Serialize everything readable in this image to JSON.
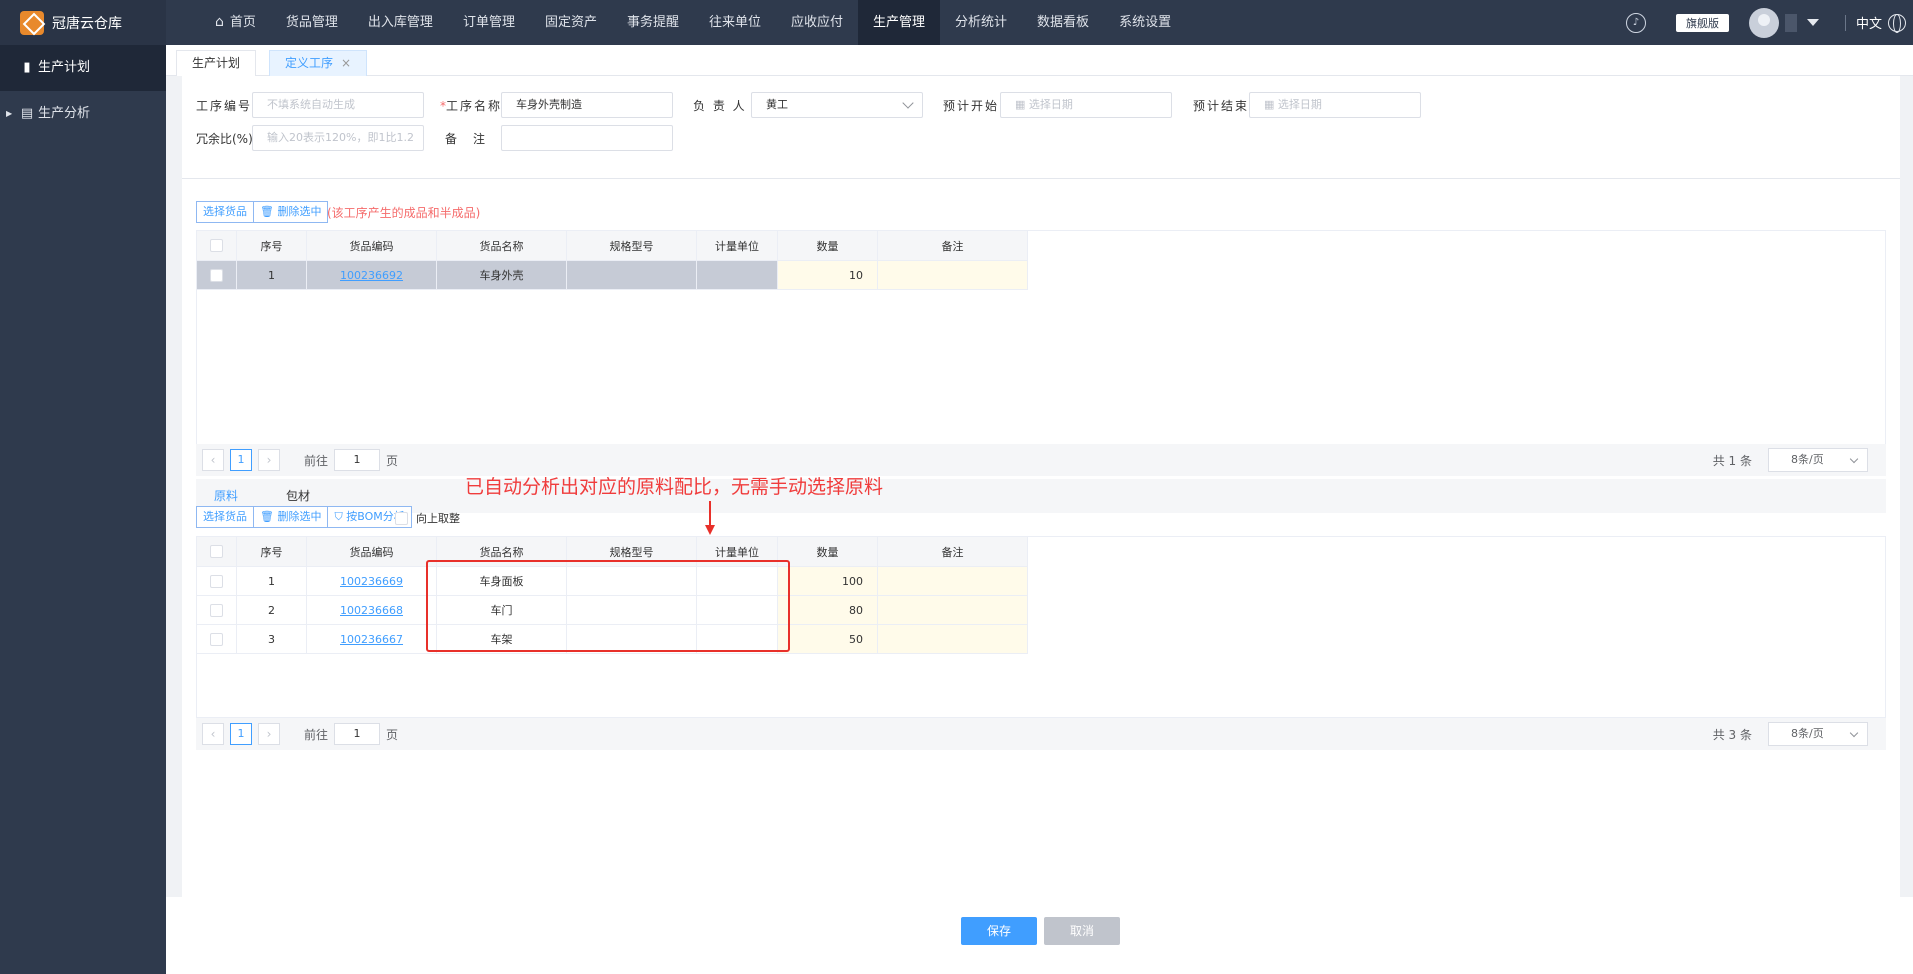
{
  "app": {
    "title": "冠唐云仓库"
  },
  "nav": {
    "home": "首页",
    "items": [
      "货品管理",
      "出入库管理",
      "订单管理",
      "固定资产",
      "事务提醒",
      "往来单位",
      "应收应付",
      "生产管理",
      "分析统计",
      "数据看板",
      "系统设置"
    ],
    "active": "生产管理"
  },
  "topright": {
    "edition": "旗舰版",
    "lang": "中文"
  },
  "sidebar": {
    "items": [
      {
        "label": "生产计划",
        "icon": "bar-chart-icon"
      },
      {
        "label": "生产分析",
        "icon": "document-icon"
      }
    ]
  },
  "tabs": [
    {
      "label": "生产计划"
    },
    {
      "label": "定义工序",
      "close": "×"
    }
  ],
  "form": {
    "code_label": "工序编号",
    "code_placeholder": "不填系统自动生成",
    "name_req": "*",
    "name_label": "工序名称",
    "name_value": "车身外壳制造",
    "owner_label": "负 责 人",
    "owner_value": "黄工",
    "start_label": "预计开始",
    "start_placeholder": "选择日期",
    "end_label": "预计结束",
    "end_placeholder": "选择日期",
    "redundancy_label": "冗余比(%)",
    "redundancy_placeholder": "输入20表示120%，即1比1.2",
    "remark_label": "备　注",
    "remark_value": ""
  },
  "product_section": {
    "select_btn": "选择货品",
    "delete_btn": "删除选中",
    "hint": "(该工序产生的成品和半成品)",
    "columns": [
      "序号",
      "货品编码",
      "货品名称",
      "规格型号",
      "计量单位",
      "数量",
      "备注"
    ],
    "rows": [
      {
        "no": "1",
        "code": "100236692",
        "name": "车身外壳",
        "spec": "",
        "unit": "",
        "qty": "10",
        "remark": ""
      }
    ],
    "pager": {
      "page": "1",
      "goto_label": "前往",
      "goto_value": "1",
      "page_suffix": "页",
      "total": "共 1 条",
      "size": "8条/页"
    }
  },
  "material_section": {
    "tabs": [
      "原料",
      "包材"
    ],
    "annotation": "已自动分析出对应的原料配比，无需手动选择原料",
    "select_btn": "选择货品",
    "delete_btn": "删除选中",
    "bom_btn": "按BOM分析",
    "round_label": "向上取整",
    "columns": [
      "序号",
      "货品编码",
      "货品名称",
      "规格型号",
      "计量单位",
      "数量",
      "备注"
    ],
    "rows": [
      {
        "no": "1",
        "code": "100236669",
        "name": "车身面板",
        "spec": "",
        "unit": "",
        "qty": "100",
        "remark": ""
      },
      {
        "no": "2",
        "code": "100236668",
        "name": "车门",
        "spec": "",
        "unit": "",
        "qty": "80",
        "remark": ""
      },
      {
        "no": "3",
        "code": "100236667",
        "name": "车架",
        "spec": "",
        "unit": "",
        "qty": "50",
        "remark": ""
      }
    ],
    "pager": {
      "page": "1",
      "goto_label": "前往",
      "goto_value": "1",
      "page_suffix": "页",
      "total": "共 3 条",
      "size": "8条/页"
    }
  },
  "footer": {
    "save": "保存",
    "cancel": "取消"
  },
  "colors": {
    "primary": "#409eff",
    "nav_bg": "#2f3a4d",
    "annotation": "#e8302a",
    "qty_bg": "#fffbea"
  }
}
